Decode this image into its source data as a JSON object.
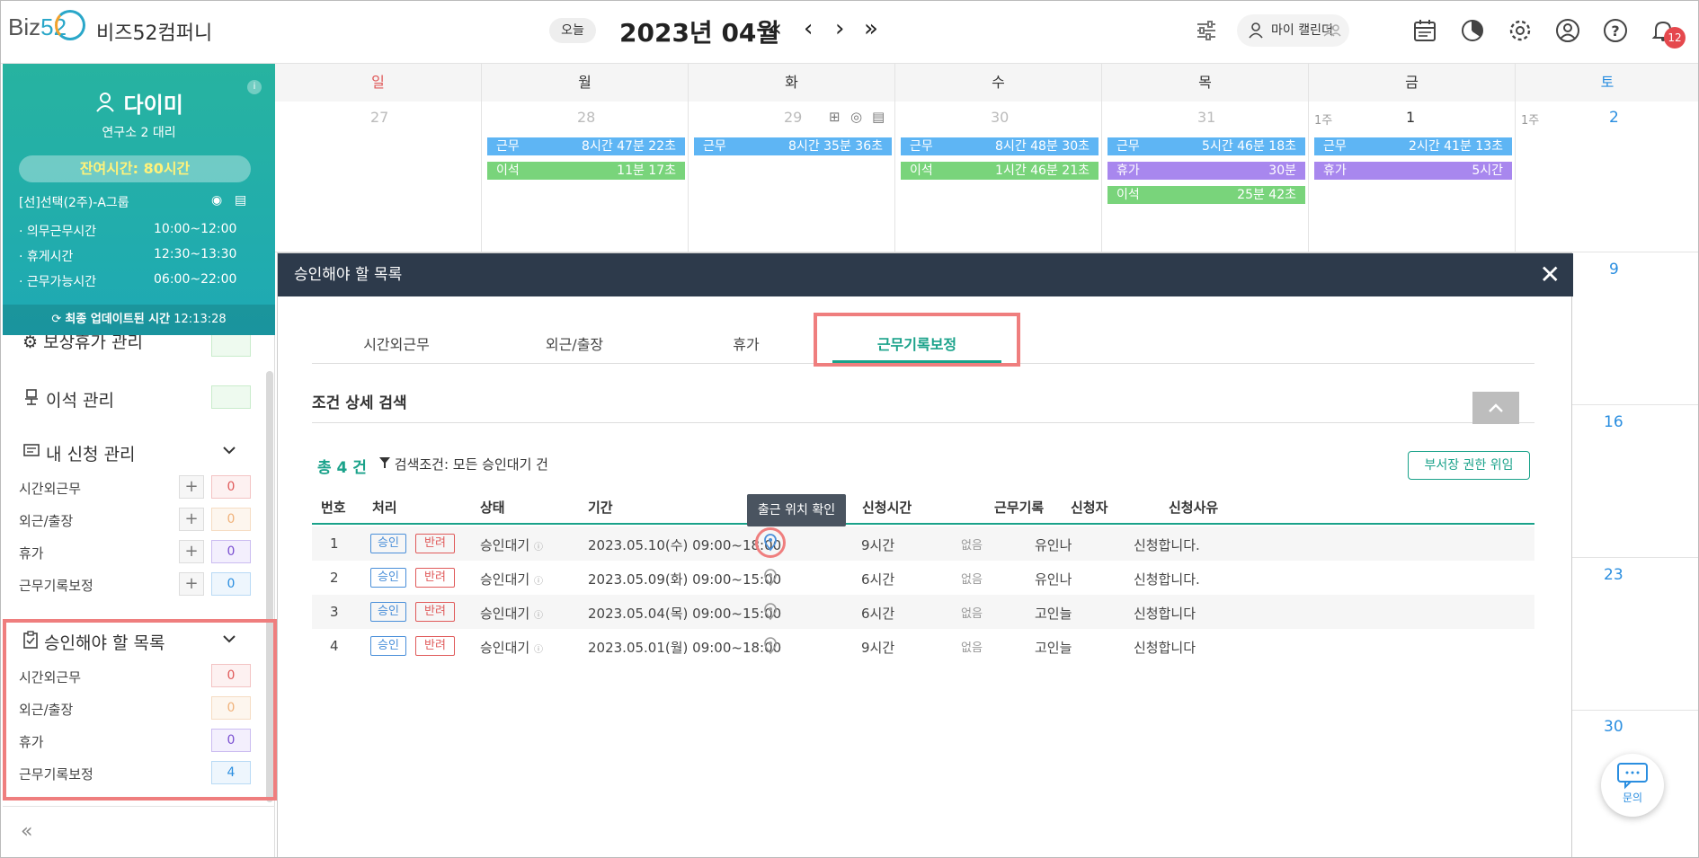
{
  "header": {
    "company": "비즈52컴퍼니",
    "today_label": "오늘",
    "month": "2023년 04월",
    "nav": [
      "«",
      "‹",
      "›",
      "»"
    ],
    "my_calendar": "마이 캘린더",
    "notification_count": "12"
  },
  "profile": {
    "name": "다이미",
    "dept": "연구소 2 대리",
    "remaining": "잔여시간: 80시간",
    "group": "[선]선택(2주)-A그룹",
    "schedule": [
      {
        "label": "· 의무근무시간",
        "value": "10:00~12:00"
      },
      {
        "label": "· 휴게시간",
        "value": "12:30~13:30"
      },
      {
        "label": "· 근무가능시간",
        "value": "06:00~22:00"
      }
    ],
    "update_label": "최종 업데이트된 시간",
    "update_time": "12:13:28"
  },
  "sidebar": {
    "compensation_leave": "보상휴가 관리",
    "away": "이석 관리",
    "my_requests": "내 신청 관리",
    "request_items": [
      {
        "label": "시간외근무",
        "count": "0"
      },
      {
        "label": "외근/출장",
        "count": "0"
      },
      {
        "label": "휴가",
        "count": "0"
      },
      {
        "label": "근무기록보정",
        "count": "0"
      }
    ],
    "approvals": "승인해야 할 목록",
    "approval_items": [
      {
        "label": "시간외근무",
        "count": "0"
      },
      {
        "label": "외근/출장",
        "count": "0"
      },
      {
        "label": "휴가",
        "count": "0"
      },
      {
        "label": "근무기록보정",
        "count": "4"
      }
    ],
    "collapse": "«"
  },
  "calendar": {
    "days": [
      "일",
      "월",
      "화",
      "수",
      "목",
      "금",
      "토"
    ],
    "dates": [
      "27",
      "28",
      "29",
      "30",
      "31",
      "1",
      "2"
    ],
    "week_label": "1주",
    "sat_dates": [
      "9",
      "16",
      "23",
      "30"
    ],
    "events": {
      "mon": [
        {
          "label": "근무",
          "value": "8시간 47분 22초"
        },
        {
          "label": "이석",
          "value": "11분 17초"
        }
      ],
      "tue": [
        {
          "label": "근무",
          "value": "8시간 35분 36초"
        }
      ],
      "wed": [
        {
          "label": "근무",
          "value": "8시간 48분 30초"
        },
        {
          "label": "이석",
          "value": "1시간 46분 21초"
        }
      ],
      "thu": [
        {
          "label": "근무",
          "value": "5시간 46분 18초"
        },
        {
          "label": "휴가",
          "value": "30분"
        },
        {
          "label": "이석",
          "value": "25분 42초"
        }
      ],
      "fri": [
        {
          "label": "근무",
          "value": "2시간 41분 13초"
        },
        {
          "label": "휴가",
          "value": "5시간"
        }
      ]
    }
  },
  "modal": {
    "title": "승인해야 할 목록",
    "tabs": [
      "시간외근무",
      "외근/출장",
      "휴가",
      "근무기록보정"
    ],
    "search_title": "조건 상세 검색",
    "total": "총 4 건",
    "condition": "검색조건: 모든 승인대기 건",
    "delegate": "부서장 권한 위임",
    "tooltip": "출근 위치 확인",
    "columns": [
      "번호",
      "처리",
      "상태",
      "기간",
      "신청시간",
      "근무기록",
      "신청자",
      "신청사유"
    ],
    "approve": "승인",
    "reject": "반려",
    "rows": [
      {
        "no": "1",
        "status": "승인대기",
        "period": "2023.05.10(수) 09:00~18:00",
        "hours": "9시간",
        "record": "없음",
        "requester": "유인나",
        "reason": "신청합니다."
      },
      {
        "no": "2",
        "status": "승인대기",
        "period": "2023.05.09(화) 09:00~15:00",
        "hours": "6시간",
        "record": "없음",
        "requester": "유인나",
        "reason": "신청합니다."
      },
      {
        "no": "3",
        "status": "승인대기",
        "period": "2023.05.04(목) 09:00~15:00",
        "hours": "6시간",
        "record": "없음",
        "requester": "고인늘",
        "reason": "신청합니다"
      },
      {
        "no": "4",
        "status": "승인대기",
        "period": "2023.05.01(월) 09:00~18:00",
        "hours": "9시간",
        "record": "없음",
        "requester": "고인늘",
        "reason": "신청합니다"
      }
    ]
  },
  "chat_label": "문의"
}
